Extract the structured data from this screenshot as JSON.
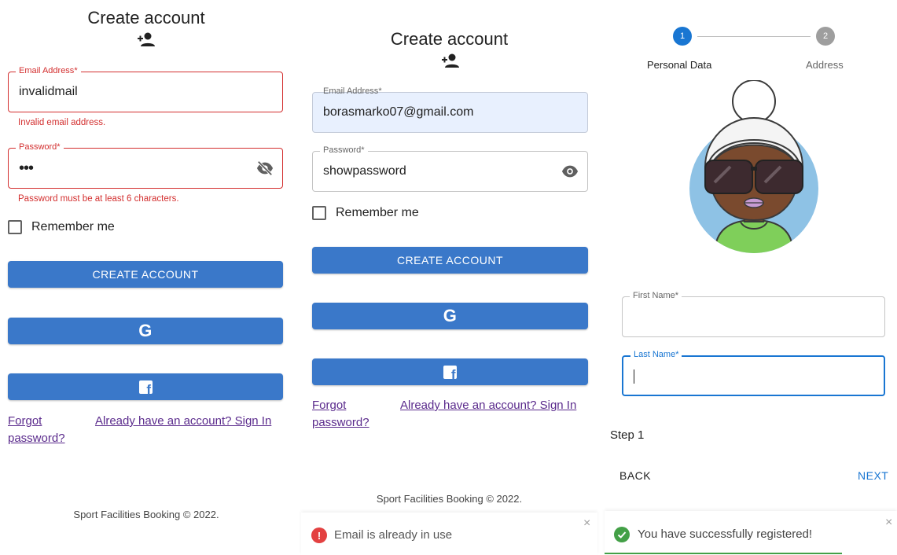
{
  "panel1": {
    "title": "Create account",
    "email": {
      "label": "Email Address",
      "required_mark": "*",
      "value": "invalidmail",
      "error": "Invalid email address."
    },
    "password": {
      "label": "Password",
      "required_mark": "*",
      "value": "•••",
      "error": "Password must be at least 6 characters."
    },
    "remember_label": "Remember me",
    "create_button": "CREATE ACCOUNT",
    "google_button_glyph": "G",
    "facebook_button_glyph": "f",
    "forgot_link": "Forgot password?",
    "signin_link": "Already have an account? Sign In",
    "footer": "Sport Facilities Booking © 2022."
  },
  "panel2": {
    "title": "Create account",
    "email": {
      "label": "Email Address",
      "required_mark": "*",
      "value": "borasmarko07@gmail.com"
    },
    "password": {
      "label": "Password",
      "required_mark": "*",
      "value": "showpassword"
    },
    "remember_label": "Remember me",
    "create_button": "CREATE ACCOUNT",
    "google_button_glyph": "G",
    "facebook_button_glyph": "f",
    "forgot_link": "Forgot password?",
    "signin_link": "Already have an account? Sign In",
    "footer": "Sport Facilities Booking © 2022.",
    "snackbar": {
      "icon_glyph": "!",
      "message": "Email is already in use",
      "close": "×"
    }
  },
  "panel3": {
    "stepper": {
      "step1_number": "1",
      "step1_label": "Personal Data",
      "step2_number": "2",
      "step2_label": "Address"
    },
    "first_name": {
      "label": "First Name",
      "required_mark": "*",
      "value": ""
    },
    "last_name": {
      "label": "Last Name",
      "required_mark": "*",
      "value": ""
    },
    "step_text": "Step 1",
    "back_button": "BACK",
    "next_button": "NEXT",
    "snackbar": {
      "message": "You have successfully registered!",
      "close": "×"
    }
  },
  "colors": {
    "primary_button": "#3a78c9",
    "error": "#d32f2f",
    "focus": "#1976d2",
    "link": "#5a2a8c",
    "success": "#43a047",
    "step_active": "#1976d2",
    "step_inactive": "#9e9e9e"
  },
  "icons": [
    "person-add-icon",
    "eye-off-icon",
    "eye-icon",
    "google-icon",
    "facebook-icon",
    "error-icon",
    "check-circle-icon",
    "close-icon",
    "avatar"
  ]
}
